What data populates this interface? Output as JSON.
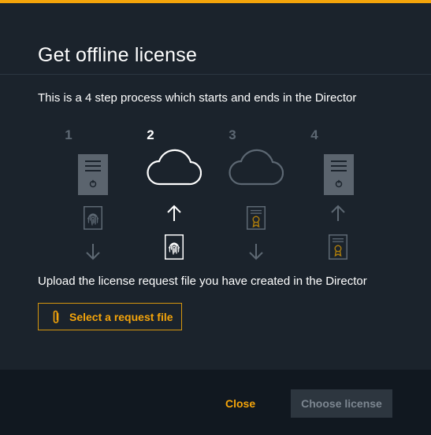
{
  "dialog": {
    "title": "Get offline license",
    "intro": "This is a 4 step process which starts and ends in the Director",
    "instruction": "Upload the license request file you have created in the Director"
  },
  "steps": [
    {
      "number": "1",
      "active": false,
      "top_icon": "server-icon",
      "arrow": "down-arrow-icon",
      "file_icon": "fingerprint-file-icon"
    },
    {
      "number": "2",
      "active": true,
      "top_icon": "cloud-icon",
      "arrow": "up-arrow-icon",
      "file_icon": "fingerprint-file-icon"
    },
    {
      "number": "3",
      "active": false,
      "top_icon": "cloud-icon",
      "arrow": "down-arrow-icon",
      "file_icon": "certificate-file-icon"
    },
    {
      "number": "4",
      "active": false,
      "top_icon": "server-icon",
      "arrow": "up-arrow-icon",
      "file_icon": "certificate-file-icon"
    }
  ],
  "upload": {
    "button_label": "Select a request file",
    "icon": "paperclip-icon"
  },
  "footer": {
    "close_label": "Close",
    "choose_label": "Choose license",
    "choose_enabled": false
  },
  "colors": {
    "accent": "#f4a40a",
    "dialog_bg": "#1b232c",
    "footer_bg": "#111820",
    "inactive": "#5d6873",
    "active": "#ffffff"
  }
}
